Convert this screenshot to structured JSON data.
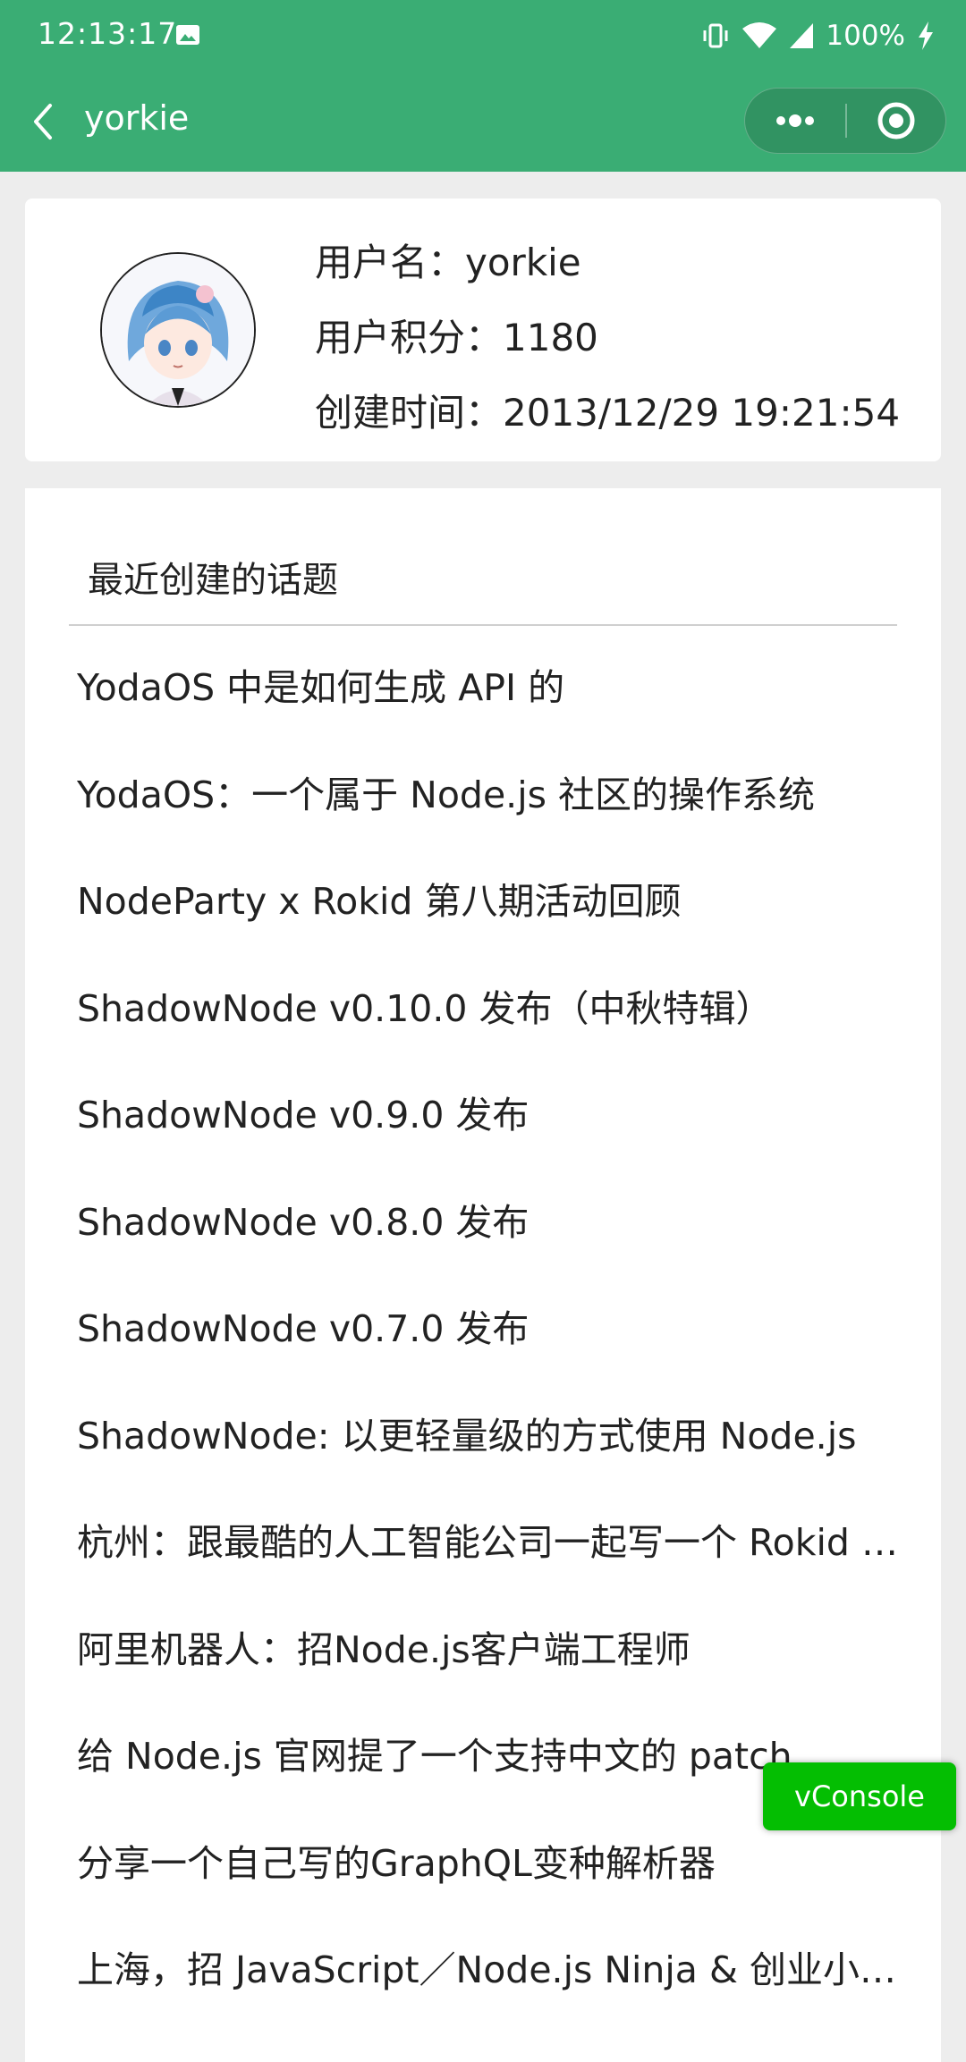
{
  "status_bar": {
    "time": "12:13:17",
    "battery": "100%",
    "icons": [
      "image-icon",
      "vibrate-icon",
      "wifi-icon",
      "signal-icon",
      "charging-icon"
    ]
  },
  "nav": {
    "title": "yorkie",
    "color": "#3aad74",
    "icons": [
      "back-icon",
      "more-icon",
      "target-icon"
    ]
  },
  "profile": {
    "username_line": "用户名：yorkie",
    "score_line": "用户积分：1180",
    "created_line": "创建时间：2013/12/29 19:21:54"
  },
  "topics": {
    "title": "最近创建的话题",
    "items": [
      "YodaOS 中是如何生成 API 的",
      "YodaOS：一个属于 Node.js 社区的操作系统",
      "NodeParty x Rokid 第八期活动回顾",
      "ShadowNode v0.10.0 发布（中秋特辑）",
      "ShadowNode v0.9.0 发布",
      "ShadowNode v0.8.0 发布",
      "ShadowNode v0.7.0 发布",
      "ShadowNode: 以更轻量级的方式使用 Node.js",
      "杭州：跟最酷的人工智能公司一起写一个 Rokid 的操作系统",
      "阿里机器人：招Node.js客户端工程师",
      "给 Node.js 官网提了一个支持中文的 patch",
      "分享一个自己写的GraphQL变种解析器",
      "上海，招 JavaScript／Node.js Ninja & 创业小伙伴"
    ]
  },
  "vconsole": {
    "label": "vConsole",
    "color": "#04be02"
  }
}
